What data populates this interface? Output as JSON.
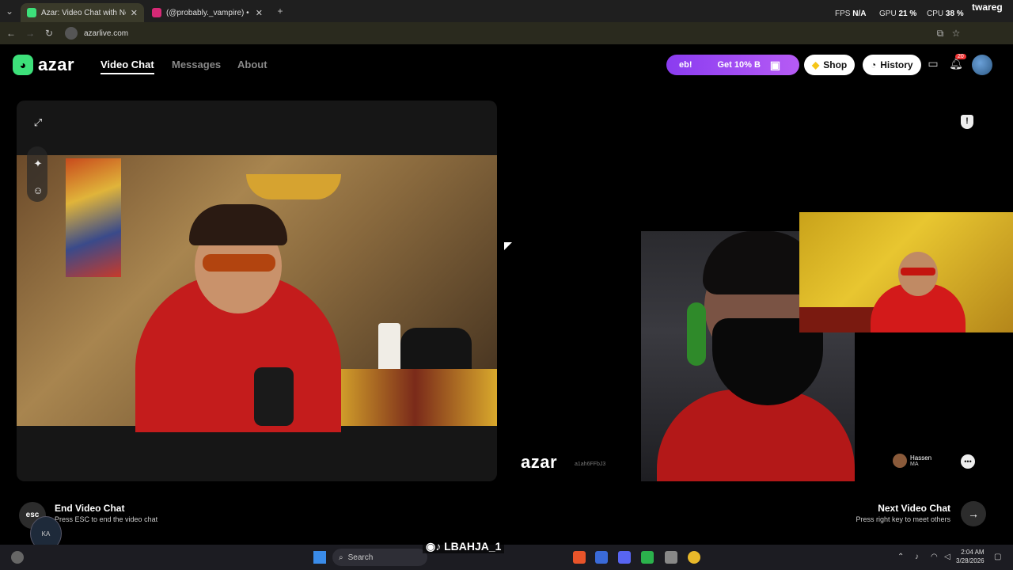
{
  "browser": {
    "tabs": [
      {
        "title": "Azar: Video Chat with New",
        "active": true,
        "favicon_color": "#3de07a"
      },
      {
        "title": "(@probably._vampire) • Instagr",
        "active": false,
        "favicon_color": "#d62976"
      }
    ],
    "new_tab": "+",
    "url": "azarlive.com",
    "perf": {
      "fps_label": "FPS",
      "fps_value": "N/A",
      "gpu_label": "GPU",
      "gpu_value": "21 %",
      "cpu_label": "CPU",
      "cpu_value": "38 %"
    }
  },
  "header": {
    "logo_text": "azar",
    "nav": [
      {
        "label": "Video Chat",
        "active": true
      },
      {
        "label": "Messages",
        "active": false
      },
      {
        "label": "About",
        "active": false
      }
    ],
    "promo_left": "eb!",
    "promo_right": "Get 10% B",
    "shop_label": "Shop",
    "history_label": "History",
    "notification_count": "20"
  },
  "peer": {
    "brand": "azar",
    "id_text": "a1ah6FFbJ3",
    "name": "Hassen",
    "country": "MA"
  },
  "controls": {
    "esc_label": "esc",
    "end_title": "End Video Chat",
    "end_sub": "Press ESC to end the video chat",
    "next_title": "Next Video Chat",
    "next_sub": "Press right key to meet others"
  },
  "overlay": {
    "streamer_tag": "twareg",
    "social_handle": "LBAHJA_1"
  },
  "taskbar": {
    "search_label": "Search",
    "time": "2:04 AM",
    "date": "3/28/2026"
  },
  "colors": {
    "accent": "#3de07a",
    "promo": "#8a3cf0"
  }
}
